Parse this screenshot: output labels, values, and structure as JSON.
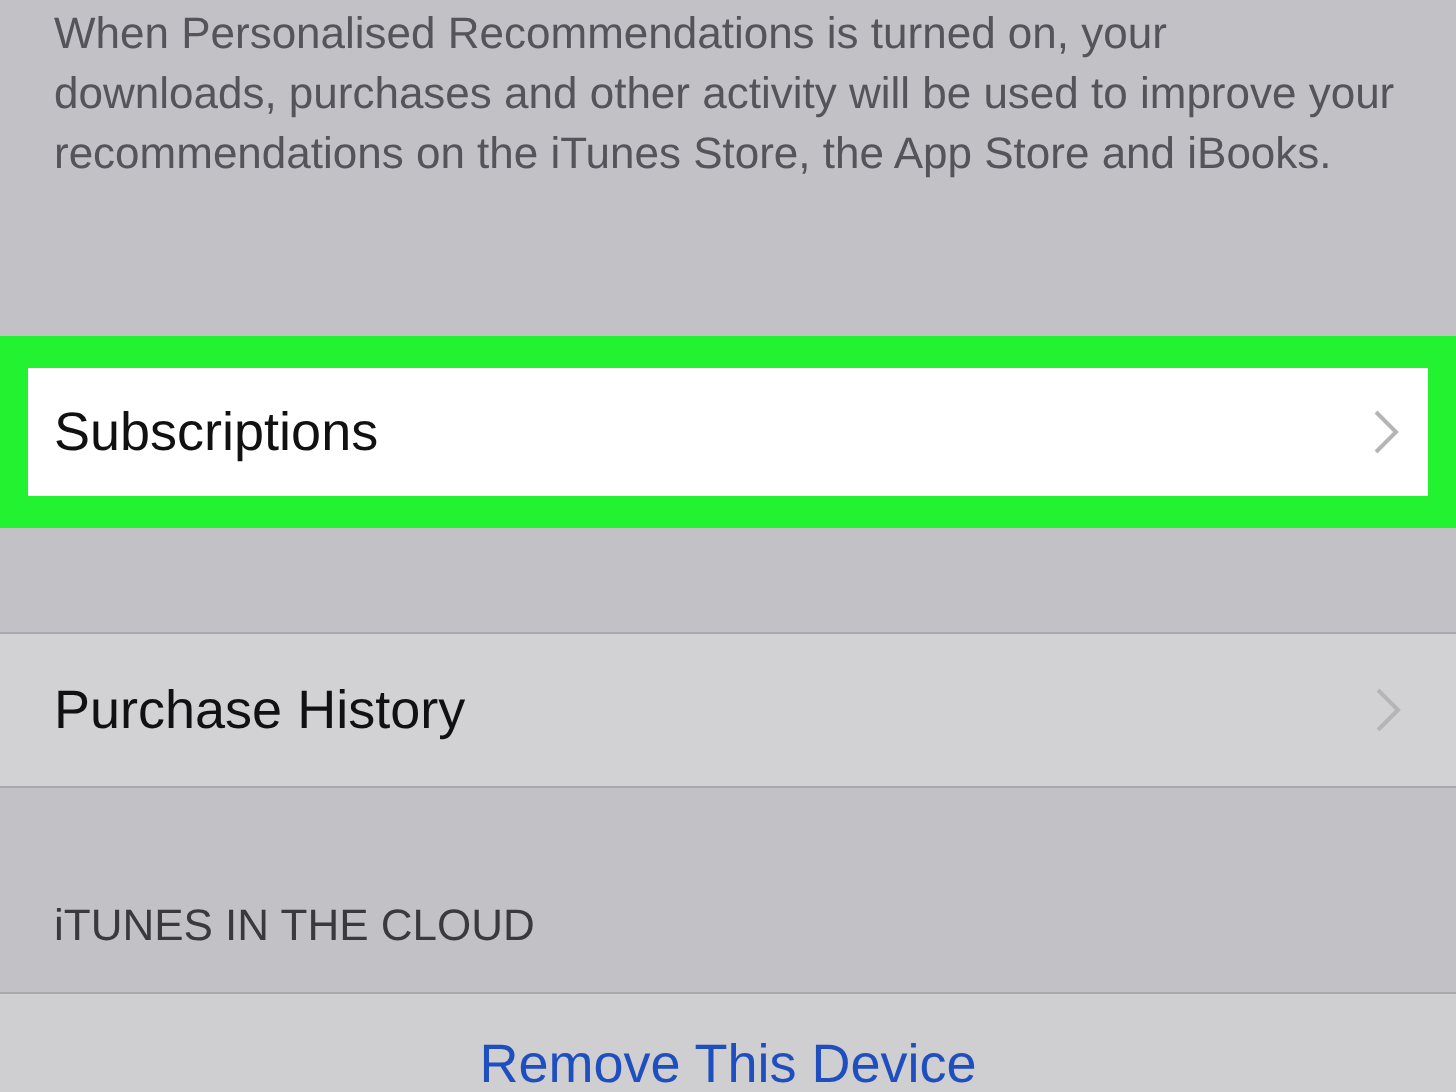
{
  "description": "When Personalised Recommendations is turned on, your downloads, purchases and other activity will be used to improve your recommendations on the iTunes Store, the App Store and iBooks.",
  "rows": [
    {
      "label": "Subscriptions",
      "highlighted": true
    },
    {
      "label": "Purchase History",
      "highlighted": false
    }
  ],
  "section_header": "iTUNES IN THE CLOUD",
  "action_link": "Remove This Device"
}
